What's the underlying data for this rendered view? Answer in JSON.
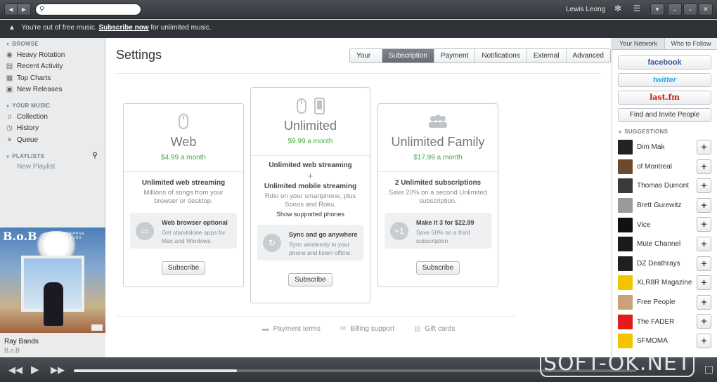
{
  "topbar": {
    "back": "◀",
    "forward": "▶",
    "search_placeholder": "",
    "username": "Lewis Leong"
  },
  "banner": {
    "prefix": "You're out of free music.",
    "link": "Subscribe now",
    "suffix": "for unlimited music."
  },
  "sidebar": {
    "browse_title": "BROWSE",
    "browse": [
      "Heavy Rotation",
      "Recent Activity",
      "Top Charts",
      "New Releases"
    ],
    "music_title": "YOUR MUSIC",
    "music": [
      "Collection",
      "History",
      "Queue"
    ],
    "playlists_title": "PLAYLISTS",
    "new_playlist": "New Playlist"
  },
  "album": {
    "artist_logo": "B.o.B",
    "album_title": "STRANGE CLOUDS"
  },
  "now_playing": {
    "track": "Ray Bands",
    "artist": "B.o.B"
  },
  "main": {
    "title": "Settings",
    "tabs": [
      "Your Info",
      "Subscription",
      "Payment",
      "Notifications",
      "External",
      "Advanced"
    ],
    "active_tab": "Subscription"
  },
  "plans": {
    "web": {
      "name": "Web",
      "price": "$4.99 a month",
      "feature_title": "Unlimited web streaming",
      "feature_desc": "Millions of songs from your browser or desktop.",
      "box_title": "Web browser optional",
      "box_desc": "Get standalone apps for Mac and Windows.",
      "button": "Subscribe"
    },
    "unlimited": {
      "name": "Unlimited",
      "price": "$9.99 a month",
      "feature_title": "Unlimited web streaming",
      "plus": "+",
      "feature2_title": "Unlimited mobile streaming",
      "feature2_desc": "Rdio on your smartphone, plus Sonos and Roku.",
      "link": "Show supported phones",
      "box_title": "Sync and go anywhere",
      "box_desc": "Sync wirelessly to your phone and listen offline.",
      "button": "Subscribe"
    },
    "family": {
      "name": "Unlimited Family",
      "price": "$17.99 a month",
      "feature_title": "2 Unlimited subscriptions",
      "feature_desc": "Save 20% on a second Unlimited subscription.",
      "box_icon": "+1",
      "box_title": "Make it 3 for $22.99",
      "box_desc": "Save 50% on a third subscription",
      "button": "Subscribe"
    }
  },
  "footer": [
    "Payment terms",
    "Billing support",
    "Gift cards"
  ],
  "right": {
    "tabs": [
      "Your Network",
      "Who to Follow"
    ],
    "facebook": "facebook",
    "twitter": "twitter",
    "lastfm": "last.fm",
    "invite": "Find and Invite People",
    "suggestions_title": "SUGGESTIONS",
    "add": "+",
    "suggestions": [
      {
        "name": "Dim Mak",
        "color": "#222222"
      },
      {
        "name": "of Montreal",
        "color": "#6b4a2e"
      },
      {
        "name": "Thomas Dumont",
        "color": "#3a3a3a"
      },
      {
        "name": "Brett Gurewitz",
        "color": "#9a9a9a"
      },
      {
        "name": "Vice",
        "color": "#111111"
      },
      {
        "name": "Mute Channel",
        "color": "#1a1a1a"
      },
      {
        "name": "DZ Deathrays",
        "color": "#202020"
      },
      {
        "name": "XLR8R Magazine",
        "color": "#f2c500"
      },
      {
        "name": "Free People",
        "color": "#c9a27a"
      },
      {
        "name": "The FADER",
        "color": "#e21b1b"
      },
      {
        "name": "SFMOMA",
        "color": "#f2c500"
      }
    ]
  },
  "player": {
    "progress": 0.29
  },
  "watermark": "SOFT-OK.NET"
}
